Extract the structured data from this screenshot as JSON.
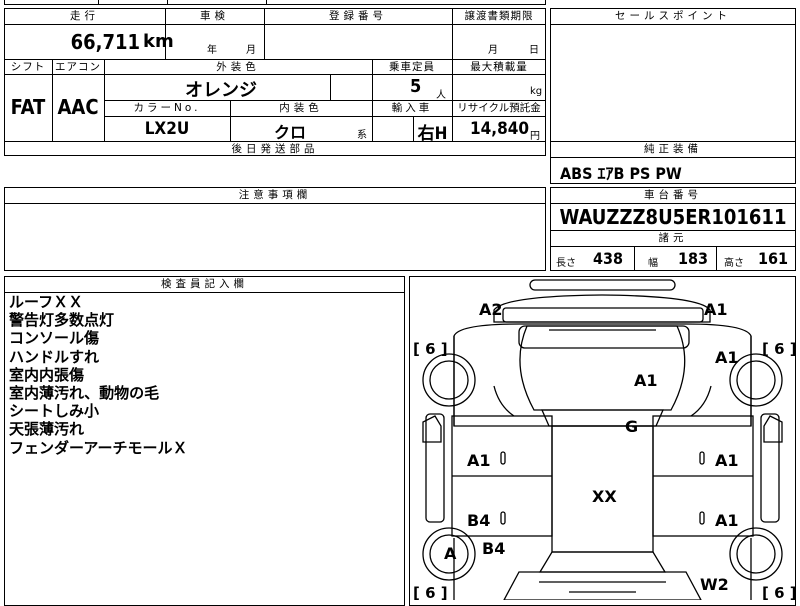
{
  "sheet": {
    "mileage_header": "走行",
    "mileage_value": "66,711",
    "mileage_unit": "km",
    "inspection_header": "車検",
    "inspection_year": "年",
    "inspection_month": "月",
    "registration_header": "登録番号",
    "transfer_header": "譲渡書類期限",
    "transfer_month": "月",
    "transfer_day": "日",
    "shift_header": "シフト",
    "shift_value": "FAT",
    "aircon_header": "エアコン",
    "aircon_value": "AAC",
    "exterior_color_header": "外装色",
    "exterior_color_value": "オレンジ",
    "capacity_header": "乗車定員",
    "capacity_value": "5",
    "capacity_unit": "人",
    "max_load_header": "最大積載量",
    "max_load_unit": "kg",
    "color_no_header": "カラーNo.",
    "color_no_value": "LX2U",
    "interior_color_header": "内装色",
    "interior_color_value": "クロ",
    "interior_color_suffix": "系",
    "import_header": "輸入車",
    "import_value": "右H",
    "recycle_header": "リサイクル預託金",
    "recycle_value": "14,840",
    "recycle_unit": "円",
    "later_parts_header": "後日発送部品",
    "caution_header": "注意事項欄",
    "sales_point_header": "セールスポイント",
    "equipment_header": "純正装備",
    "equipment_value": "ABS ｴｱB PS PW",
    "chassis_header": "車台番号",
    "chassis_value": "WAUZZZ8U5ER101611",
    "spec_header": "諸元",
    "length_label": "長さ",
    "length_value": "438",
    "width_label": "幅",
    "width_value": "183",
    "height_label": "高さ",
    "height_value": "161",
    "inspector_header": "検査員記入欄",
    "inspector_notes": [
      "ルーフＸＸ",
      "警告灯多数点灯",
      "コンソール傷",
      "ハンドルすれ",
      "室内内張傷",
      "室内薄汚れ、動物の毛",
      "シートしみ小",
      "天張薄汚れ",
      "フェンダーアーチモールＸ"
    ]
  },
  "diagram": {
    "tires": [
      "[ 6 ]",
      "[ 6 ]",
      "[ 6 ]",
      "[ 6 ]"
    ],
    "marks": [
      "A2",
      "A1",
      "A1",
      "A1",
      "G",
      "A1",
      "A1",
      "XX",
      "B4",
      "A1",
      "B4",
      "A",
      "W2"
    ]
  }
}
